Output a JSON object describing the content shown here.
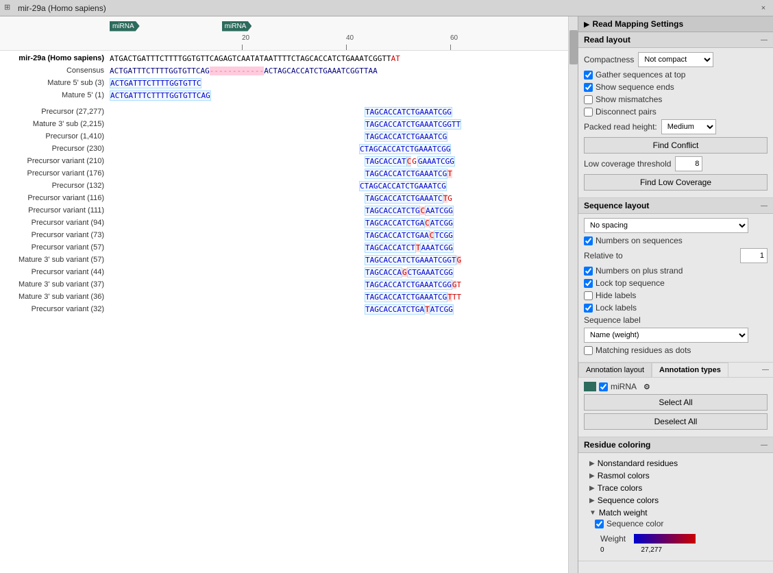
{
  "titleBar": {
    "text": "mir-29a (Homo sapiens)",
    "closeLabel": "×"
  },
  "ruler": {
    "marks": [
      {
        "value": "20",
        "pos": 208
      },
      {
        "value": "40",
        "pos": 360
      },
      {
        "value": "60",
        "pos": 512
      }
    ]
  },
  "sequences": [
    {
      "label": "",
      "labelClass": "",
      "type": "mirna-row"
    },
    {
      "label": "mir-29a (Homo sapiens)",
      "labelClass": "main",
      "seq": "ATGACTGATTTCTTTTGGTGTTCAGAGTCAATATAATTTTCTAGCACCATCTGAAATCGGTT AT",
      "type": "genomic"
    },
    {
      "label": "Consensus",
      "labelClass": "",
      "seq": "ACTGATTTCTTTTGGTGTTCAG------------ACTAGCACCATCTGAAATCGGTTAA",
      "type": "consensus"
    },
    {
      "label": "Mature 5' sub (3)",
      "labelClass": "",
      "seq": "ACTGATTTCTTTTGGTGTTC",
      "offset": 0,
      "type": "read"
    },
    {
      "label": "Mature 5' (1)",
      "labelClass": "",
      "seq": "ACTGATTTCTTTTGGTGTTCAG",
      "offset": 0,
      "type": "read"
    },
    {
      "label": "Precursor (27,277)",
      "labelClass": "",
      "seq": "TAGCACCATCTGAAATCGG",
      "offset": 44,
      "type": "read-right"
    },
    {
      "label": "Mature 3' sub (2,215)",
      "seq": "TAGCACCATCTGAAATCGGTT",
      "offset": 44,
      "type": "read-right"
    },
    {
      "label": "Precursor (1,410)",
      "seq": "TAGCACCATCTGAAATCG",
      "offset": 44,
      "type": "read-right"
    },
    {
      "label": "Precursor (230)",
      "seq": "CTAGCACCATCTGAAATCGG",
      "offset": 43,
      "type": "read-right"
    },
    {
      "label": "Precursor variant (210)",
      "seq": "TAGCACCATCGGAAATCGGx",
      "offset": 44,
      "type": "read-right-variant",
      "variantPos": 10,
      "variantChar": "G"
    },
    {
      "label": "Precursor variant (176)",
      "seq": "TAGCACCATCTGAAATCGTx",
      "offset": 44,
      "type": "read-right-variant",
      "variantPos": 18,
      "variantChar": "T"
    },
    {
      "label": "Precursor (132)",
      "seq": "CTAGCACCATCTGAAATCG",
      "offset": 43,
      "type": "read-right"
    },
    {
      "label": "Precursor variant (116)",
      "seq": "TAGCACCATCTGAAATCTGx",
      "offset": 44,
      "type": "read-right-variant",
      "variantPos": 17,
      "variantChar": "T"
    },
    {
      "label": "Precursor variant (111)",
      "seq": "TAGCACCATCTGCAATCGGx",
      "offset": 44,
      "type": "read-right-variant",
      "variantPos": 11,
      "variantChar": "C"
    },
    {
      "label": "Precursor variant (94)",
      "seq": "TAGCACCATCTGACATCGGx",
      "offset": 44,
      "type": "read-right-variant",
      "variantPos": 12,
      "variantChar": "C"
    },
    {
      "label": "Precursor variant (73)",
      "seq": "TAGCACCATCTGAACTCGGx",
      "offset": 44,
      "type": "read-right-variant",
      "variantPos": 13,
      "variantChar": "C"
    },
    {
      "label": "Precursor variant (57)",
      "seq": "TAGCACCATCTTAAATCGGx",
      "offset": 44,
      "type": "read-right-variant",
      "variantPos": 10,
      "variantChar": "T"
    },
    {
      "label": "Mature 3' sub variant (57)",
      "seq": "TAGCACCATCTGAAATCGGTG",
      "offset": 44,
      "type": "read-right-variant-end",
      "variantPos": 20,
      "variantChar": "G"
    },
    {
      "label": "Precursor variant (44)",
      "seq": "TAGCACCAGCTGAAATCGGx",
      "offset": 44,
      "type": "read-right-variant",
      "variantPos": 8,
      "variantChar": "G"
    },
    {
      "label": "Mature 3' sub variant (37)",
      "seq": "TAGCACCATCTGAAATCGGGTx",
      "offset": 44,
      "type": "read-right-variant-end",
      "variantPos": 19,
      "variantChar": "G"
    },
    {
      "label": "Mature 3' sub variant (36)",
      "seq": "TAGCACCATCTGAAATCGTTTx",
      "offset": 44,
      "type": "read-right-variant",
      "variantPos": 18,
      "variantChar": "T"
    },
    {
      "label": "Precursor variant (32)",
      "seq": "TAGCACCATCTGATATCGGx",
      "offset": 44,
      "type": "read-right-variant",
      "variantPos": 13,
      "variantChar": "T"
    }
  ],
  "settings": {
    "panelTitle": "Read Mapping Settings",
    "readLayout": {
      "title": "Read layout",
      "compactnessLabel": "Compactness",
      "compactnessValue": "Not compact",
      "gatherSequences": true,
      "gatherSequencesLabel": "Gather sequences at top",
      "showSequenceEnds": true,
      "showSequenceEndsLabel": "Show sequence ends",
      "showMismatches": false,
      "showMismatchesLabel": "Show mismatches",
      "disconnectPairs": false,
      "disconnectPairsLabel": "Disconnect pairs",
      "packedReadHeightLabel": "Packed read height:",
      "packedReadHeightValue": "Medium",
      "findConflictLabel": "Find Conflict",
      "lowCoverageLabel": "Low coverage threshold",
      "lowCoverageValue": "8",
      "findLowCoverageLabel": "Find Low Coverage"
    },
    "sequenceLayout": {
      "title": "Sequence layout",
      "spacingValue": "No spacing",
      "numbersOnSequences": true,
      "numbersOnSequencesLabel": "Numbers on sequences",
      "relativeTo": "1",
      "relativeToLabel": "Relative to",
      "numbersOnPlusStrand": true,
      "numbersOnPlusStrandLabel": "Numbers on plus strand",
      "lockTopSequence": true,
      "lockTopSequenceLabel": "Lock top sequence",
      "hideLabels": false,
      "hideLabelsLabel": "Hide labels",
      "lockLabels": true,
      "lockLabelsLabel": "Lock labels",
      "sequenceLabelLabel": "Sequence label",
      "sequenceLabelValue": "Name (weight)",
      "matchingResiduesLabel": "Matching residues as dots",
      "matchingResidues": false
    },
    "annotationLayout": {
      "title": "Annotation layout",
      "tabs": [
        "Annotation layout",
        "Annotation types"
      ],
      "activeTab": "Annotation types",
      "mirnaLabel": "miRNA",
      "selectAllLabel": "Select All",
      "deselectAllLabel": "Deselect All"
    },
    "residueColoring": {
      "title": "Residue coloring",
      "items": [
        "Nonstandard residues",
        "Rasmol colors",
        "Trace colors",
        "Sequence colors",
        "Match weight"
      ],
      "matchWeightExpanded": true,
      "sequenceColorLabel": "Sequence color",
      "sequenceColorChecked": true,
      "weightLabel": "Weight",
      "weightMin": "0",
      "weightMax": "27,277"
    }
  }
}
